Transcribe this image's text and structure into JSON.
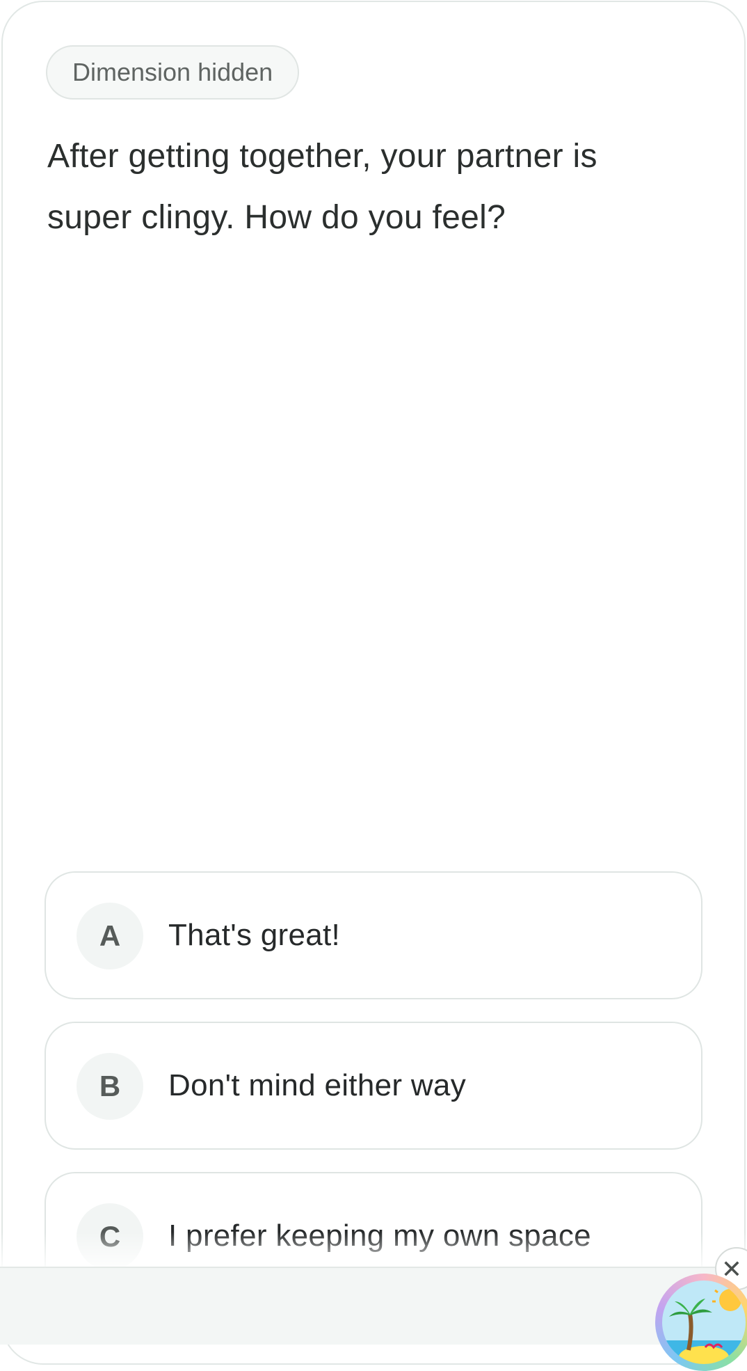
{
  "dimension_chip": "Dimension hidden",
  "question": "After getting together, your partner is super clingy. How do you feel?",
  "options": [
    {
      "letter": "A",
      "text": "That's great!"
    },
    {
      "letter": "B",
      "text": "Don't mind either way"
    },
    {
      "letter": "C",
      "text": "I prefer keeping my own space"
    }
  ],
  "bottom": {
    "close_icon": "close-icon",
    "badge_icon": "beach-island-icon"
  }
}
